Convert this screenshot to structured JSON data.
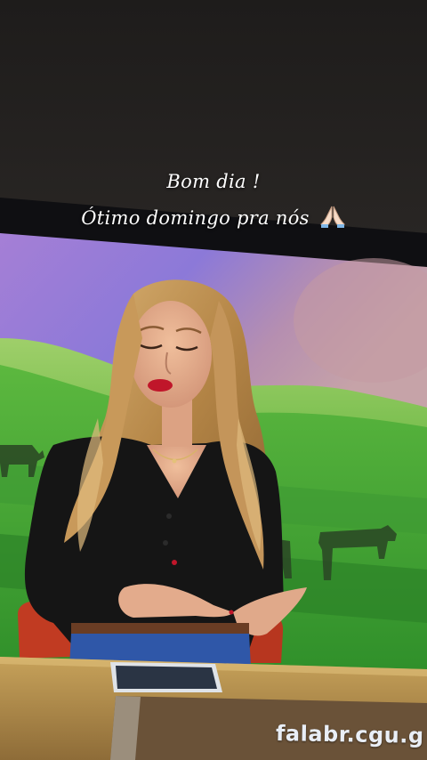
{
  "caption": {
    "line1": "Bom dia !",
    "line2": "Ótimo domingo pra nós",
    "emoji": "praying-hands-emoji"
  },
  "watermark": {
    "text": "falabr.cgu.g"
  },
  "scene": {
    "description_icon": "tv-presenter-photo",
    "colors": {
      "ceiling": "#1b1918",
      "screen_sky": "#8f6fc9",
      "screen_grass": "#4fae3c",
      "desk": "#b08a4a",
      "blouse": "#141414",
      "hair": "#c69a5a",
      "chair": "#c5391f"
    }
  }
}
